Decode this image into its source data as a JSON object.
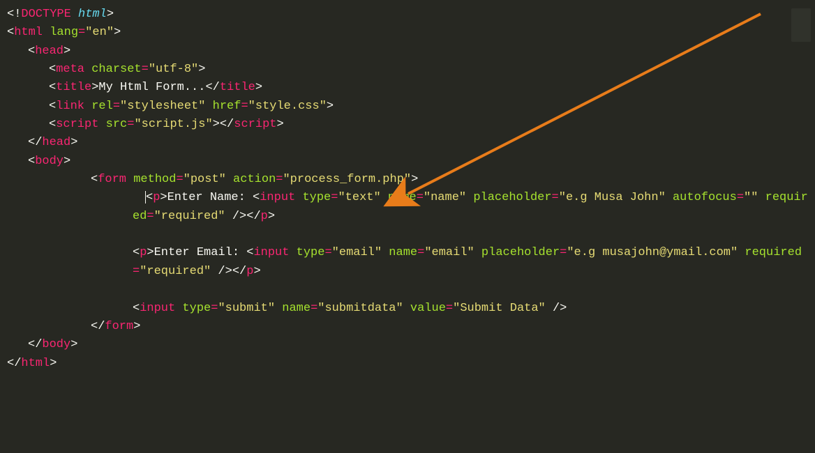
{
  "lines": {
    "l1a": "<!",
    "l1b": "DOCTYPE",
    "l1c": " html",
    "l1d": ">",
    "l2a": "<",
    "l2b": "html",
    "l2c": " lang",
    "l2d": "=",
    "l2e": "\"en\"",
    "l2f": ">",
    "l3a": "<",
    "l3b": "head",
    "l3c": ">",
    "l4a": "<",
    "l4b": "meta",
    "l4c": " charset",
    "l4d": "=",
    "l4e": "\"utf-8\"",
    "l4f": ">",
    "l5a": "<",
    "l5b": "title",
    "l5c": ">",
    "l5d": "My Html Form...",
    "l5e": "</",
    "l5f": "title",
    "l5g": ">",
    "l6a": "<",
    "l6b": "link",
    "l6c": " rel",
    "l6d": "=",
    "l6e": "\"stylesheet\"",
    "l6f": " href",
    "l6g": "=",
    "l6h": "\"style.css\"",
    "l6i": ">",
    "l7a": "<",
    "l7b": "script",
    "l7c": " src",
    "l7d": "=",
    "l7e": "\"script.js\"",
    "l7f": "></",
    "l7g": "script",
    "l7h": ">",
    "l8a": "</",
    "l8b": "head",
    "l8c": ">",
    "l9a": "<",
    "l9b": "body",
    "l9c": ">",
    "l10a": "<",
    "l10b": "form",
    "l10c": " method",
    "l10d": "=",
    "l10e": "\"post\"",
    "l10f": " action",
    "l10g": "=",
    "l10h": "\"process_form.php\"",
    "l10i": ">",
    "l11a": "<",
    "l11b": "p",
    "l11c": ">",
    "l11d": "Enter Name: ",
    "l11e": "<",
    "l11f": "input",
    "l11g": " type",
    "l11h": "=",
    "l11i": "\"text\"",
    "l11j": " name",
    "l11k": "=",
    "l11l": "\"name\"",
    "l11m": " placeholder",
    "l11n": "=",
    "l11o": "\"e.g Musa John\"",
    "l11p": " autofocus",
    "l11q": "=",
    "l11r": "\"\"",
    "l11s": " required",
    "l11t": "=",
    "l11u": "\"required\"",
    "l11v": " />",
    "l11w": "</",
    "l11x": "p",
    "l11y": ">",
    "l12a": "<",
    "l12b": "p",
    "l12c": ">",
    "l12d": "Enter Email: ",
    "l12e": "<",
    "l12f": "input",
    "l12g": " type",
    "l12h": "=",
    "l12i": "\"email\"",
    "l12j": " name",
    "l12k": "=",
    "l12l": "\"email\"",
    "l12m": " placeholder",
    "l12n": "=",
    "l12o": "\"e.g musajohn@ymail.com\"",
    "l12p": " required",
    "l12q": "=",
    "l12r": "\"required\"",
    "l12s": " />",
    "l12t": "</",
    "l12u": "p",
    "l12v": ">",
    "l13a": "<",
    "l13b": "input",
    "l13c": " type",
    "l13d": "=",
    "l13e": "\"submit\"",
    "l13f": " name",
    "l13g": "=",
    "l13h": "\"submitdata\"",
    "l13i": " value",
    "l13j": "=",
    "l13k": "\"Submit Data\"",
    "l13l": " />",
    "l14a": "</",
    "l14b": "form",
    "l14c": ">",
    "l15a": "</",
    "l15b": "body",
    "l15c": ">",
    "l16a": "</",
    "l16b": "html",
    "l16c": ">"
  }
}
